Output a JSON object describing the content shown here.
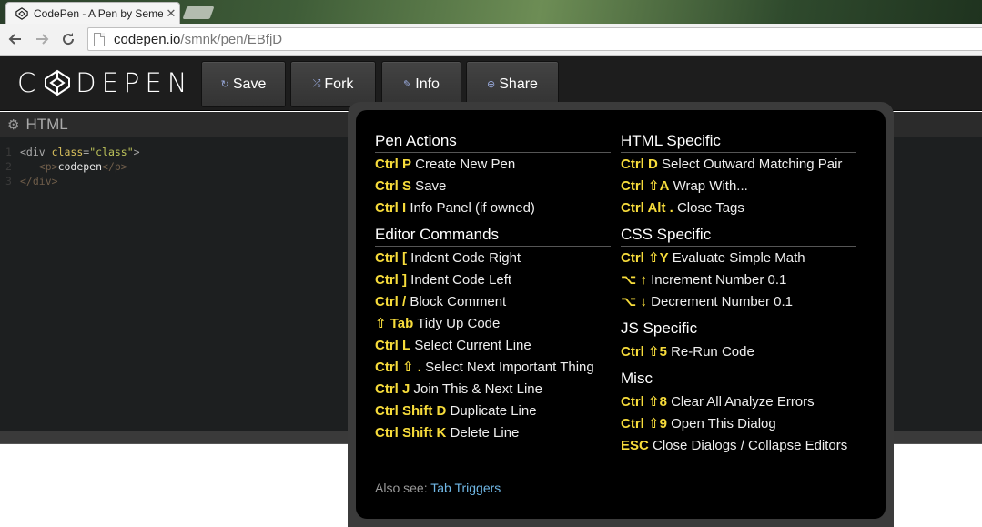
{
  "browser": {
    "tab_title": "CodePen - A Pen by Seme",
    "tab_close": "✕",
    "url_host": "codepen.io",
    "url_path": "/smnk/pen/EBfjD"
  },
  "header": {
    "logo_left": "C",
    "logo_right": "DEPEN",
    "buttons": [
      {
        "icon": "↻",
        "label": "Save"
      },
      {
        "icon": "⤮",
        "label": "Fork"
      },
      {
        "icon": "✎",
        "label": "Info"
      },
      {
        "icon": "⊕",
        "label": "Share"
      }
    ]
  },
  "editor": {
    "title": "HTML",
    "lines": [
      {
        "n": "1"
      },
      {
        "n": "2"
      },
      {
        "n": "3"
      }
    ]
  },
  "shortcuts": {
    "left": [
      {
        "title": "Pen Actions",
        "items": [
          {
            "key": "Ctrl P",
            "desc": "Create New Pen"
          },
          {
            "key": "Ctrl S",
            "desc": "Save"
          },
          {
            "key": "Ctrl I",
            "desc": "Info Panel (if owned)"
          }
        ]
      },
      {
        "title": "Editor Commands",
        "items": [
          {
            "key": "Ctrl [",
            "desc": "Indent Code Right"
          },
          {
            "key": "Ctrl ]",
            "desc": "Indent Code Left"
          },
          {
            "key": "Ctrl /",
            "desc": "Block Comment"
          },
          {
            "key": "⇧ Tab",
            "desc": "Tidy Up Code"
          },
          {
            "key": "Ctrl L",
            "desc": "Select Current Line"
          },
          {
            "key": "Ctrl ⇧ .",
            "desc": "Select Next Important Thing"
          },
          {
            "key": "Ctrl J",
            "desc": "Join This & Next Line"
          },
          {
            "key": "Ctrl Shift D",
            "desc": "Duplicate Line"
          },
          {
            "key": "Ctrl Shift K",
            "desc": "Delete Line"
          }
        ]
      }
    ],
    "right": [
      {
        "title": "HTML Specific",
        "items": [
          {
            "key": "Ctrl D",
            "desc": "Select Outward Matching Pair"
          },
          {
            "key": "Ctrl ⇧A",
            "desc": "Wrap With..."
          },
          {
            "key": "Ctrl Alt .",
            "desc": "Close Tags"
          }
        ]
      },
      {
        "title": "CSS Specific",
        "items": [
          {
            "key": "Ctrl ⇧Y",
            "desc": "Evaluate Simple Math"
          },
          {
            "key": "⌥ ↑",
            "desc": "Increment Number 0.1"
          },
          {
            "key": "⌥ ↓",
            "desc": "Decrement Number 0.1"
          }
        ]
      },
      {
        "title": "JS Specific",
        "items": [
          {
            "key": "Ctrl ⇧5",
            "desc": "Re-Run Code"
          }
        ]
      },
      {
        "title": "Misc",
        "items": [
          {
            "key": "Ctrl ⇧8",
            "desc": "Clear All Analyze Errors"
          },
          {
            "key": "Ctrl ⇧9",
            "desc": "Open This Dialog"
          },
          {
            "key": "ESC",
            "desc": "Close Dialogs / Collapse Editors"
          }
        ]
      }
    ],
    "also_see_label": "Also see:",
    "also_see_link": "Tab Triggers"
  }
}
